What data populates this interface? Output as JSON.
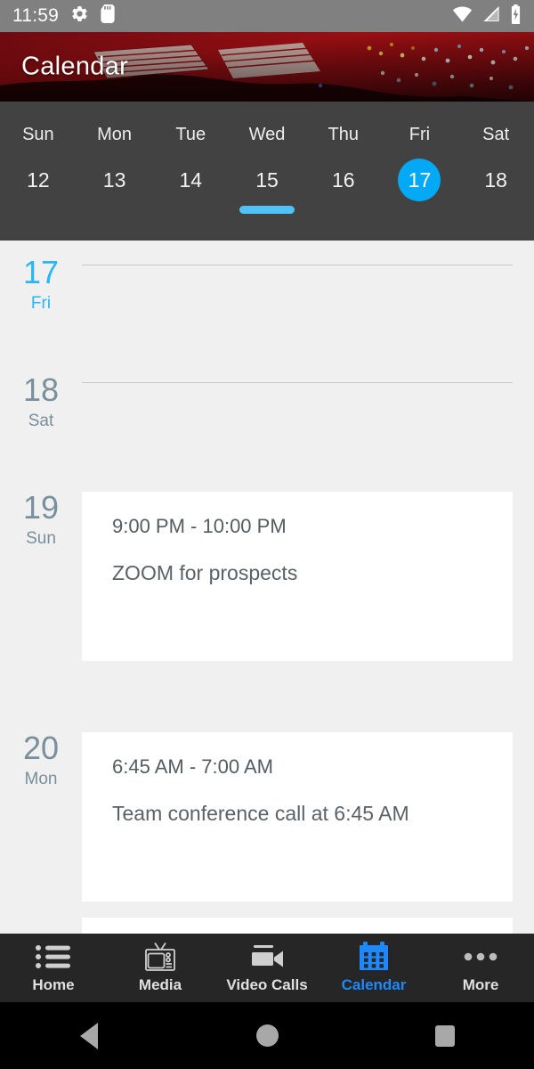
{
  "statusbar": {
    "time": "11:59",
    "icons_left": [
      "gear-icon",
      "sd-card-icon"
    ],
    "icons_right": [
      "wifi-icon",
      "cell-signal-icon",
      "battery-charging-icon"
    ],
    "background": "#808080"
  },
  "header": {
    "title": "Calendar",
    "background_type": "arena-crowd-photo",
    "background_accent": "#8a0f12"
  },
  "weekstrip": {
    "background": "#424242",
    "selected_color": "#03a9f4",
    "indicator_color": "#4fc3f7",
    "days": [
      {
        "dow": "Sun",
        "date": "12",
        "selected": false,
        "indicator": false
      },
      {
        "dow": "Mon",
        "date": "13",
        "selected": false,
        "indicator": false
      },
      {
        "dow": "Tue",
        "date": "14",
        "selected": false,
        "indicator": false
      },
      {
        "dow": "Wed",
        "date": "15",
        "selected": false,
        "indicator": true
      },
      {
        "dow": "Thu",
        "date": "16",
        "selected": false,
        "indicator": false
      },
      {
        "dow": "Fri",
        "date": "17",
        "selected": true,
        "indicator": false
      },
      {
        "dow": "Sat",
        "date": "18",
        "selected": false,
        "indicator": false
      }
    ]
  },
  "agenda": {
    "background": "#f0f0f0",
    "today_color": "#29b6f6",
    "day_color": "#78909c",
    "days": [
      {
        "date": "17",
        "dow": "Fri",
        "today": true,
        "events": []
      },
      {
        "date": "18",
        "dow": "Sat",
        "today": false,
        "events": []
      },
      {
        "date": "19",
        "dow": "Sun",
        "today": false,
        "events": [
          {
            "time": "9:00 PM - 10:00 PM",
            "title": "ZOOM for prospects"
          }
        ]
      },
      {
        "date": "20",
        "dow": "Mon",
        "today": false,
        "events": [
          {
            "time": "6:45 AM - 7:00 AM",
            "title": "Team conference call at 6:45 AM"
          }
        ]
      }
    ]
  },
  "tabbar": {
    "background": "#262626",
    "active_color": "#1e88ff",
    "inactive_color": "#e0e0e0",
    "items": [
      {
        "label": "Home",
        "icon": "bulleted-list-icon",
        "active": false
      },
      {
        "label": "Media",
        "icon": "retro-tv-icon",
        "active": false
      },
      {
        "label": "Video Calls",
        "icon": "video-camera-icon",
        "active": false
      },
      {
        "label": "Calendar",
        "icon": "calendar-icon",
        "active": true
      },
      {
        "label": "More",
        "icon": "three-dots-icon",
        "active": false
      }
    ]
  },
  "sysnav": {
    "background": "#000000",
    "buttons": [
      "back-button",
      "home-button",
      "recents-button"
    ]
  }
}
